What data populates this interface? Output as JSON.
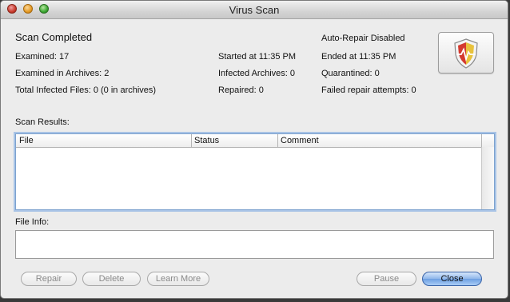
{
  "window": {
    "title": "Virus Scan"
  },
  "summary": {
    "heading": "Scan Completed",
    "examined": "Examined:  17",
    "examined_archives": "Examined in Archives:  2",
    "total_infected": "Total Infected Files:  0 (0 in archives)",
    "started": "Started at 11:35 PM",
    "infected_archives": "Infected Archives: 0",
    "repaired": "Repaired: 0",
    "auto_repair": "Auto-Repair Disabled",
    "ended": "Ended at 11:35 PM",
    "quarantined": "Quarantined: 0",
    "failed_repair": "Failed repair attempts: 0"
  },
  "results": {
    "label": "Scan Results:",
    "columns": [
      "File",
      "Status",
      "Comment"
    ],
    "rows": []
  },
  "file_info": {
    "label": "File Info:",
    "value": ""
  },
  "buttons": {
    "repair": "Repair",
    "delete": "Delete",
    "learn_more": "Learn More",
    "pause": "Pause",
    "close": "Close"
  },
  "icons": {
    "app": "antivirus-shield-icon"
  }
}
